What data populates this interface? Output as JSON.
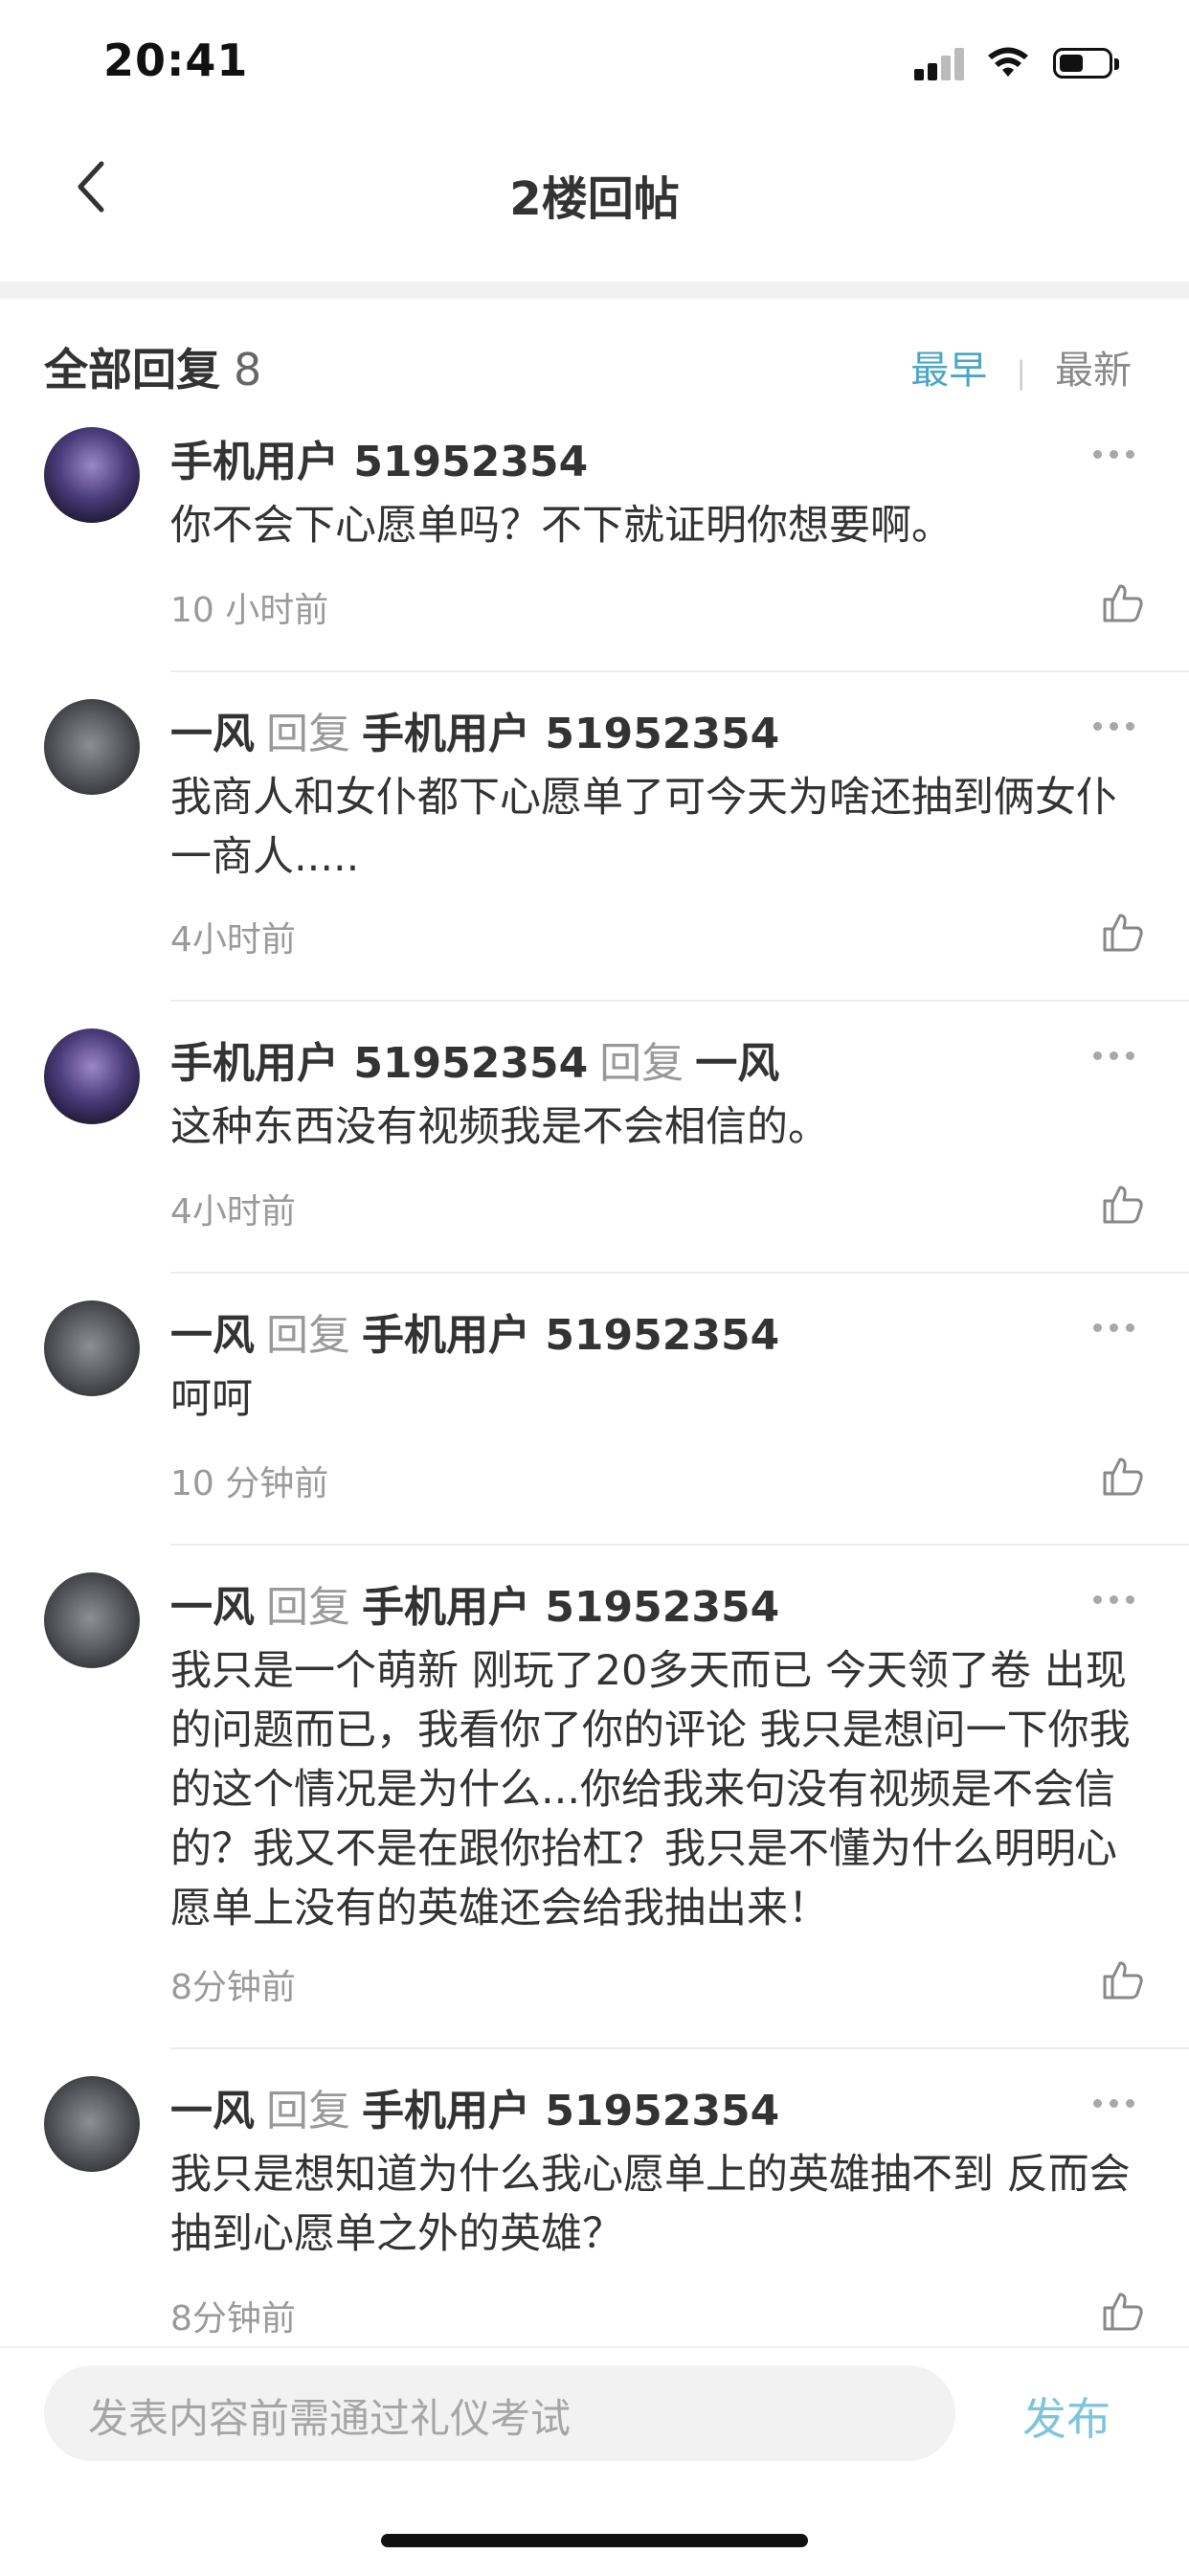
{
  "status_bar": {
    "time": "20:41"
  },
  "nav": {
    "title": "2楼回帖"
  },
  "header": {
    "label": "全部回复",
    "count": "8"
  },
  "sort": {
    "active": "最早",
    "separator": "|",
    "inactive": "最新"
  },
  "comments": [
    {
      "author": "手机用户 51952354",
      "reply_word": "",
      "reply_to": "",
      "avatar": "anime-girl",
      "text": "你不会下心愿单吗？不下就证明你想要啊。",
      "time": "10 小时前"
    },
    {
      "author": "一风",
      "reply_word": "回复",
      "reply_to": "手机用户 51952354",
      "avatar": "gray-cat",
      "text": "我商人和女仆都下心愿单了可今天为啥还抽到俩女仆一商人.....",
      "time": "4小时前"
    },
    {
      "author": "手机用户 51952354",
      "reply_word": "回复",
      "reply_to": "一风",
      "avatar": "anime-girl",
      "text": "这种东西没有视频我是不会相信的。",
      "time": "4小时前"
    },
    {
      "author": "一风",
      "reply_word": "回复",
      "reply_to": "手机用户 51952354",
      "avatar": "gray-cat",
      "text": "呵呵",
      "time": "10 分钟前"
    },
    {
      "author": "一风",
      "reply_word": "回复",
      "reply_to": "手机用户 51952354",
      "avatar": "gray-cat",
      "text": "我只是一个萌新 刚玩了20多天而已 今天领了卷 出现的问题而已，我看你了你的评论 我只是想问一下你我的这个情况是为什么...你给我来句没有视频是不会信的？我又不是在跟你抬杠？我只是不懂为什么明明心愿单上没有的英雄还会给我抽出来！",
      "time": "8分钟前"
    },
    {
      "author": "一风",
      "reply_word": "回复",
      "reply_to": "手机用户 51952354",
      "avatar": "gray-cat",
      "text": "我只是想知道为什么我心愿单上的英雄抽不到 反而会抽到心愿单之外的英雄？",
      "time": "8分钟前"
    }
  ],
  "composer": {
    "placeholder": "发表内容前需通过礼仪考试",
    "publish_label": "发布"
  },
  "colors": {
    "accent": "#4aa7c7",
    "publish": "#7fc4dc"
  }
}
